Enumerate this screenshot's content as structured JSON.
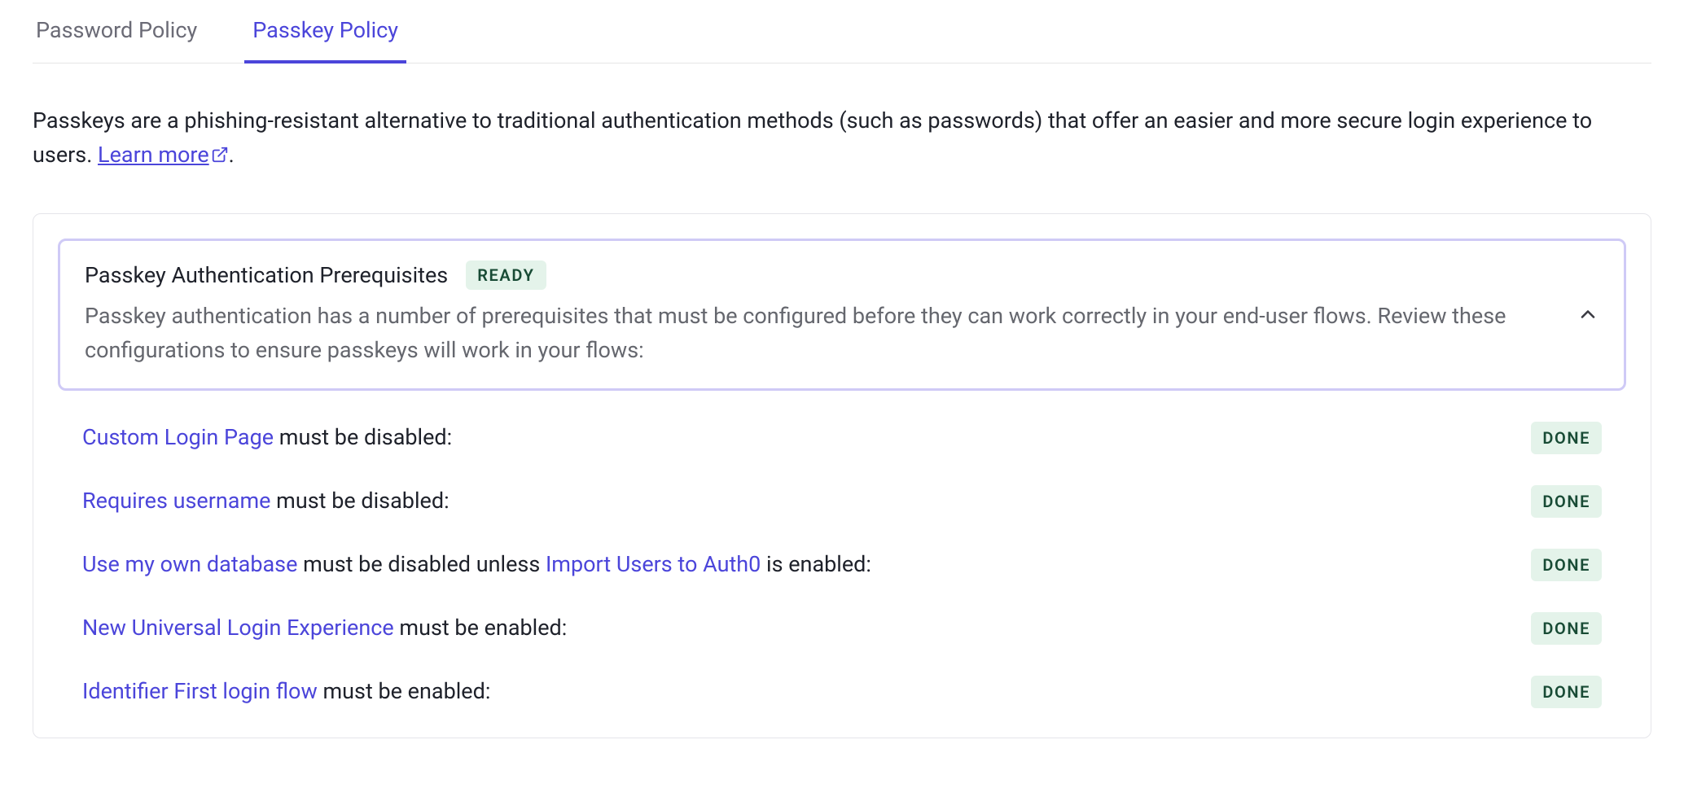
{
  "tabs": {
    "password": "Password Policy",
    "passkey": "Passkey Policy"
  },
  "intro": {
    "text": "Passkeys are a phishing-resistant alternative to traditional authentication methods (such as passwords) that offer an easier and more secure login experience to users. ",
    "learn_more": "Learn more",
    "period": "."
  },
  "prereq": {
    "title": "Passkey Authentication Prerequisites",
    "ready_badge": "READY",
    "desc": "Passkey authentication has a number of prerequisites that must be configured before they can work correctly in your end-user flows. Review these configurations to ensure passkeys will work in your flows:"
  },
  "done_label": "DONE",
  "items": [
    {
      "link1": "Custom Login Page",
      "mid": " must be disabled:",
      "link2": "",
      "tail": ""
    },
    {
      "link1": "Requires username",
      "mid": " must be disabled:",
      "link2": "",
      "tail": ""
    },
    {
      "link1": "Use my own database",
      "mid": " must be disabled unless ",
      "link2": "Import Users to Auth0",
      "tail": " is enabled:"
    },
    {
      "link1": "New Universal Login Experience",
      "mid": " must be enabled:",
      "link2": "",
      "tail": ""
    },
    {
      "link1": "Identifier First login flow",
      "mid": " must be enabled:",
      "link2": "",
      "tail": ""
    }
  ]
}
